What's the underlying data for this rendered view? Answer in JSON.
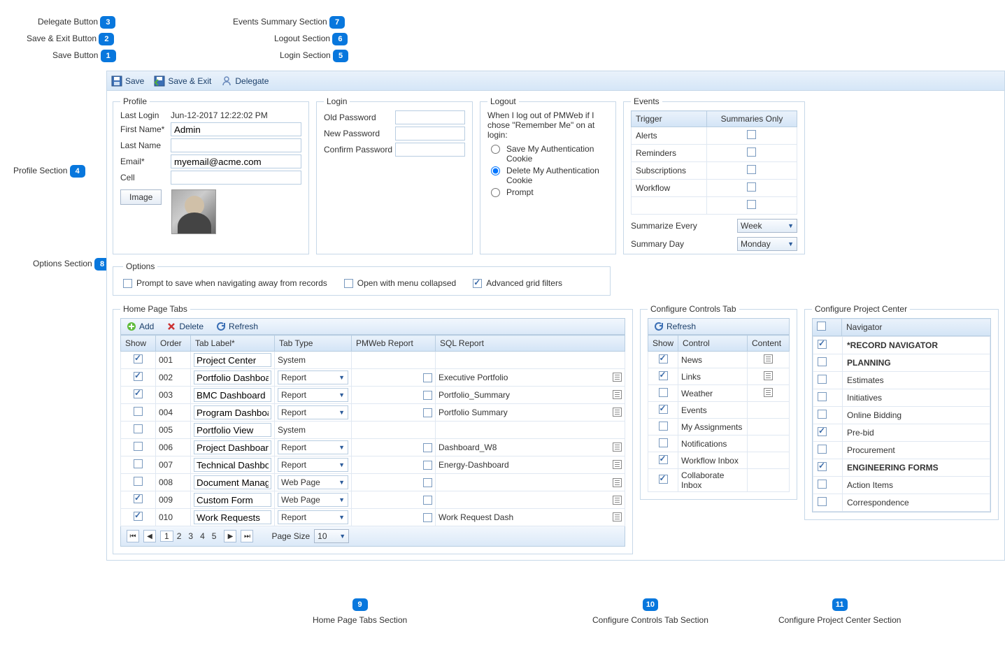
{
  "toolbar": {
    "save": "Save",
    "saveExit": "Save & Exit",
    "delegate": "Delegate"
  },
  "annotations": {
    "a1": "Save Button",
    "a2": "Save & Exit Button",
    "a3": "Delegate Button",
    "a4": "Profile Section",
    "a5": "Login Section",
    "a6": "Logout Section",
    "a7": "Events Summary Section",
    "a8": "Options Section",
    "a9": "Home Page Tabs Section",
    "a10": "Configure Controls Tab Section",
    "a11": "Configure Project Center Section"
  },
  "profile": {
    "legend": "Profile",
    "lastLoginLabel": "Last Login",
    "lastLoginVal": "Jun-12-2017 12:22:02 PM",
    "firstNameLabel": "First Name*",
    "firstNameVal": "Admin",
    "lastNameLabel": "Last Name",
    "lastNameVal": "",
    "emailLabel": "Email*",
    "emailVal": "myemail@acme.com",
    "cellLabel": "Cell",
    "cellVal": "",
    "imageBtn": "Image"
  },
  "login": {
    "legend": "Login",
    "oldPw": "Old Password",
    "newPw": "New Password",
    "confirmPw": "Confirm Password"
  },
  "logout": {
    "legend": "Logout",
    "intro": "When I log out of PMWeb if I chose \"Remember Me\" on at login:",
    "opt1": "Save My Authentication Cookie",
    "opt2": "Delete My Authentication Cookie",
    "opt3": "Prompt"
  },
  "events": {
    "legend": "Events",
    "hTrigger": "Trigger",
    "hSummaries": "Summaries Only",
    "rows": [
      "Alerts",
      "Reminders",
      "Subscriptions",
      "Workflow",
      ""
    ],
    "summarizeLabel": "Summarize Every",
    "summarizeVal": "Week",
    "summaryDayLabel": "Summary Day",
    "summaryDayVal": "Monday"
  },
  "options": {
    "legend": "Options",
    "o1": "Prompt to save when navigating away from records",
    "o2": "Open with menu collapsed",
    "o3": "Advanced grid filters"
  },
  "homeTabs": {
    "legend": "Home Page Tabs",
    "add": "Add",
    "delete": "Delete",
    "refresh": "Refresh",
    "hShow": "Show",
    "hOrder": "Order",
    "hLabel": "Tab Label*",
    "hType": "Tab Type",
    "hPmweb": "PMWeb Report",
    "hSql": "SQL Report",
    "rows": [
      {
        "show": true,
        "order": "001",
        "label": "Project Center",
        "type": "System",
        "pm": false,
        "sql": "",
        "sqlIcon": false
      },
      {
        "show": true,
        "order": "002",
        "label": "Portfolio Dashboard",
        "type": "Report",
        "pm": true,
        "sql": "Executive Portfolio",
        "sqlIcon": true
      },
      {
        "show": true,
        "order": "003",
        "label": "BMC Dashboard",
        "type": "Report",
        "pm": true,
        "sql": "Portfolio_Summary",
        "sqlIcon": true
      },
      {
        "show": false,
        "order": "004",
        "label": "Program Dashboard",
        "type": "Report",
        "pm": true,
        "sql": "Portfolio Summary",
        "sqlIcon": true
      },
      {
        "show": false,
        "order": "005",
        "label": "Portfolio View",
        "type": "System",
        "pm": false,
        "sql": "",
        "sqlIcon": false
      },
      {
        "show": false,
        "order": "006",
        "label": "Project Dashboard",
        "type": "Report",
        "pm": true,
        "sql": "Dashboard_W8",
        "sqlIcon": true
      },
      {
        "show": false,
        "order": "007",
        "label": "Technical Dashboard",
        "type": "Report",
        "pm": true,
        "sql": "Energy-Dashboard",
        "sqlIcon": true
      },
      {
        "show": false,
        "order": "008",
        "label": "Document Manager",
        "type": "Web Page",
        "pm": true,
        "sql": "",
        "sqlIcon": true
      },
      {
        "show": true,
        "order": "009",
        "label": "Custom Form",
        "type": "Web Page",
        "pm": true,
        "sql": "",
        "sqlIcon": true
      },
      {
        "show": true,
        "order": "010",
        "label": "Work Requests",
        "type": "Report",
        "pm": true,
        "sql": "Work Request Dash",
        "sqlIcon": true
      }
    ],
    "pageSizeLabel": "Page Size",
    "pageSizeVal": "10",
    "pages": [
      "1",
      "2",
      "3",
      "4",
      "5"
    ]
  },
  "controlsTab": {
    "legend": "Configure Controls Tab",
    "refresh": "Refresh",
    "hShow": "Show",
    "hControl": "Control",
    "hContent": "Content",
    "rows": [
      {
        "show": true,
        "control": "News",
        "hasContent": true
      },
      {
        "show": true,
        "control": "Links",
        "hasContent": true
      },
      {
        "show": false,
        "control": "Weather",
        "hasContent": true
      },
      {
        "show": true,
        "control": "Events",
        "hasContent": false
      },
      {
        "show": false,
        "control": "My Assignments",
        "hasContent": false
      },
      {
        "show": false,
        "control": "Notifications",
        "hasContent": false
      },
      {
        "show": true,
        "control": "Workflow Inbox",
        "hasContent": false
      },
      {
        "show": true,
        "control": "Collaborate Inbox",
        "hasContent": false
      }
    ]
  },
  "projCenter": {
    "legend": "Configure Project Center",
    "hNav": "Navigator",
    "rows": [
      {
        "chk": true,
        "label": "*RECORD NAVIGATOR",
        "bold": true
      },
      {
        "chk": false,
        "label": "PLANNING",
        "bold": true
      },
      {
        "chk": false,
        "label": "Estimates",
        "bold": false
      },
      {
        "chk": false,
        "label": "Initiatives",
        "bold": false
      },
      {
        "chk": false,
        "label": "Online Bidding",
        "bold": false
      },
      {
        "chk": true,
        "label": "Pre-bid",
        "bold": false
      },
      {
        "chk": false,
        "label": "Procurement",
        "bold": false
      },
      {
        "chk": true,
        "label": "ENGINEERING FORMS",
        "bold": true
      },
      {
        "chk": false,
        "label": "Action Items",
        "bold": false
      },
      {
        "chk": false,
        "label": "Correspondence",
        "bold": false
      }
    ]
  }
}
